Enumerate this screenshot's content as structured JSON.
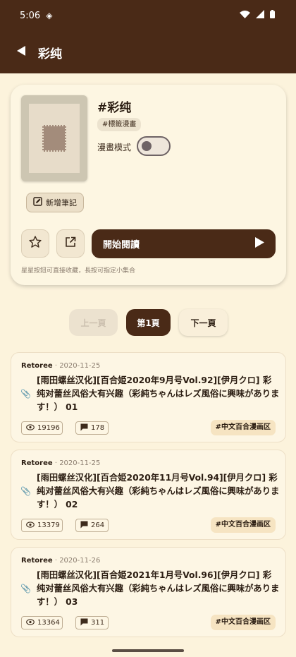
{
  "status_bar": {
    "time": "5:06"
  },
  "app_bar": {
    "title": "彩纯"
  },
  "tag_card": {
    "title": "#彩纯",
    "chip": "#標籤漫畫",
    "mode_label": "漫畫模式",
    "mode_enabled": false,
    "add_note_label": "新增筆記",
    "start_reading_label": "開始閱讀",
    "hint": "星星按鈕可直接收藏，長按可指定小集合"
  },
  "pagination": {
    "prev_label": "上一頁",
    "current_label": "第1頁",
    "next_label": "下一頁"
  },
  "posts": [
    {
      "author": "Retoree",
      "date": "2020-11-25",
      "title": "[雨田螺丝汉化][百合姫2020年9月号Vol.92][伊月クロ] 彩纯对蕾丝风俗大有兴趣（彩純ちゃんはレズ風俗に興味があります！） 01",
      "views": "19196",
      "comments": "178",
      "forum": "#中文百合漫画区"
    },
    {
      "author": "Retoree",
      "date": "2020-11-25",
      "title": "[雨田螺丝汉化][百合姫2020年11月号Vol.94][伊月クロ] 彩纯对蕾丝风俗大有兴趣（彩純ちゃんはレズ風俗に興味があります！） 02",
      "views": "13379",
      "comments": "264",
      "forum": "#中文百合漫画区"
    },
    {
      "author": "Retoree",
      "date": "2020-11-26",
      "title": "[雨田螺丝汉化][百合姫2021年1月号Vol.96][伊月クロ] 彩纯对蕾丝风俗大有兴趣（彩純ちゃんはレズ風俗に興味があります！） 03",
      "views": "13364",
      "comments": "311",
      "forum": "#中文百合漫画区"
    }
  ],
  "colors": {
    "primary_brown": "#4a2a17",
    "background": "#fcf3dc",
    "card": "#fdf6e2",
    "forum_tag_bg": "#f6e4c2"
  },
  "icons": [
    "back-icon",
    "star-icon",
    "share-icon",
    "edit-icon",
    "play-icon",
    "eye-icon",
    "comment-icon",
    "paperclip-icon",
    "wifi-icon",
    "signal-icon",
    "battery-icon"
  ]
}
